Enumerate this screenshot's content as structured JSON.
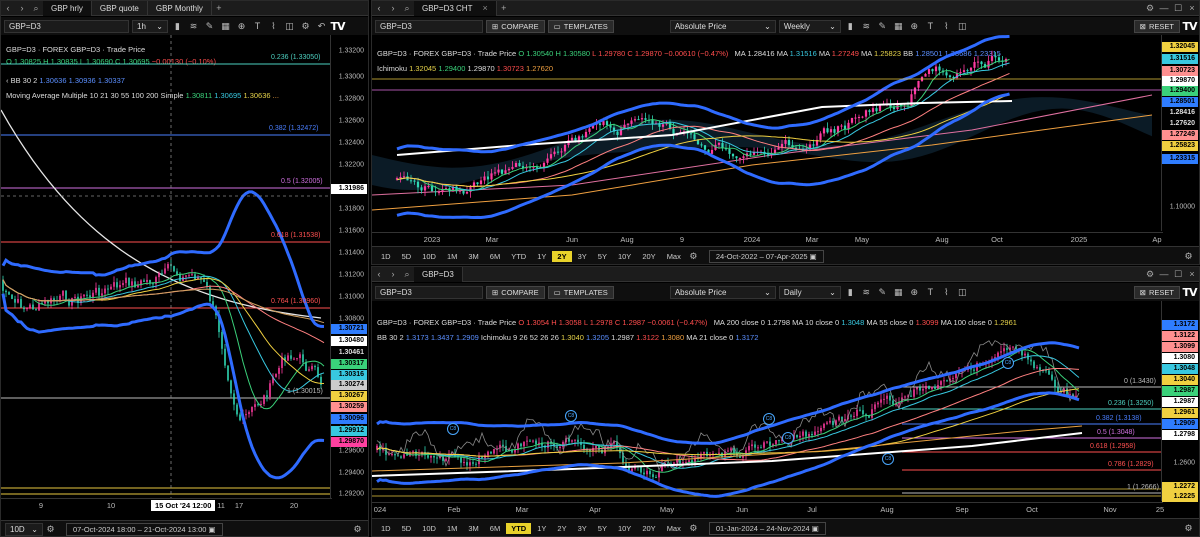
{
  "left": {
    "tabs": [
      {
        "label": "GBP hrly",
        "active": true
      },
      {
        "label": "GBP quote"
      },
      {
        "label": "GBP Monthly"
      }
    ],
    "symbol": "GBP=D3",
    "interval": "1h",
    "legend": {
      "title": "GBP=D3 · FOREX GBP=D3 · Trade Price",
      "o": "O 1.30825",
      "h": "H 1.30835",
      "l": "L 1.30690",
      "c": "C 1.30695",
      "chg": "−0.00130 (−0.10%)",
      "bb_name": "BB 30 2",
      "bb_v1": "1.30636",
      "bb_v2": "1.30936",
      "bb_v3": "1.30337",
      "ma_name": "Moving Average Multiple 10 21 30 55 100 200 Simple",
      "ma_v1": "1.30811",
      "ma_v2": "1.30695",
      "ma_v3": "1.30636",
      "ma_more": "..."
    },
    "fibs": [
      {
        "label": "0.236 (1.33050)",
        "color": "#4dd0c0"
      },
      {
        "label": "0.382 (1.32472)",
        "color": "#4a7fff"
      },
      {
        "label": "0.5 (1.32005)",
        "color": "#d070e0"
      },
      {
        "label": "0.618 (1.31538)",
        "color": "#ff5050"
      },
      {
        "label": "0.764 (1.30960)",
        "color": "#ff5050"
      },
      {
        "label": "1 (1.30015)",
        "color": "#bbbbbb"
      }
    ],
    "price_ticks": [
      "1.33200",
      "1.33000",
      "1.32800",
      "1.32600",
      "1.32400",
      "1.32200",
      "1.31800",
      "1.31600",
      "1.31400",
      "1.31200",
      "1.31000",
      "1.30800",
      "1.30600",
      "1.30400",
      "1.30200",
      "1.30000",
      "1.29800",
      "1.29600",
      "1.29400",
      "1.29200"
    ],
    "price_tags": [
      {
        "text": "1.31986",
        "bg": "#ffffff"
      },
      {
        "text": "1.30721",
        "bg": "#2f7dff"
      },
      {
        "text": "1.30480",
        "bg": "#ffffff"
      },
      {
        "text": "1.30461",
        "bg": "#000000",
        "fg": "#ddd"
      },
      {
        "text": "1.30317",
        "bg": "#3ad17a"
      },
      {
        "text": "1.30316",
        "bg": "#38c8e0"
      },
      {
        "text": "1.30274",
        "bg": "#cccccc"
      },
      {
        "text": "1.30267",
        "bg": "#f0d040"
      },
      {
        "text": "1.30259",
        "bg": "#ff9090"
      },
      {
        "text": "1.30096",
        "bg": "#2f7dff"
      },
      {
        "text": "1.29912",
        "bg": "#38c8e0"
      },
      {
        "text": "1.29870",
        "bg": "#ff40a0"
      }
    ],
    "time_ticks": [
      "9",
      "10",
      "11",
      "17",
      "20"
    ],
    "crosshair_time": "15 Oct '24  12:00",
    "range_select": "10D",
    "date_range": "07-Oct-2024 18:00 – 21-Oct-2024 13:00"
  },
  "rtop": {
    "tab": "GBP=D3 CHT",
    "symbol": "GBP=D3",
    "compare": "COMPARE",
    "templates": "TEMPLATES",
    "price_mode": "Absolute Price",
    "interval": "Weekly",
    "reset": "RESET",
    "legend": {
      "title": "GBP=D3 · FOREX GBP=D3 · Trade Price",
      "o": "O 1.30540",
      "h": "H 1.30580",
      "l": "L 1.29780",
      "c": "C 1.29870",
      "chg": "−0.00610 (−0.47%)",
      "ma1_name": "MA",
      "ma1_v": "1.28416",
      "ma2_name": "MA",
      "ma2_v": "1.31516",
      "ma3_name": "MA",
      "ma3_v": "1.27249",
      "ma4_name": "MA",
      "ma4_v": "1.25823",
      "bb_name": "BB",
      "bb_v1": "1.28501",
      "bb_v2": "1.33686",
      "bb_v3": "1.23315",
      "ichi_name": "Ichimoku",
      "ichi_v1": "1.32045",
      "ichi_v2": "1.29400",
      "ichi_v3": "1.29870",
      "ichi_v4": "1.30723",
      "ichi_v5": "1.27620"
    },
    "price_ticks": [
      "1.10000"
    ],
    "price_tags": [
      {
        "text": "1.32045",
        "bg": "#f0d040"
      },
      {
        "text": "1.31516",
        "bg": "#38c8e0"
      },
      {
        "text": "1.30723",
        "bg": "#ff9090"
      },
      {
        "text": "1.29870",
        "bg": "#ffffff"
      },
      {
        "text": "1.29400",
        "bg": "#3ad17a"
      },
      {
        "text": "1.28501",
        "bg": "#2f7dff"
      },
      {
        "text": "1.28416",
        "bg": "#000000",
        "fg": "#ddd"
      },
      {
        "text": "1.27620",
        "bg": "#000000",
        "fg": "#ddd"
      },
      {
        "text": "1.27249",
        "bg": "#ff9090"
      },
      {
        "text": "1.25823",
        "bg": "#f0d040"
      },
      {
        "text": "1.23315",
        "bg": "#2f7dff"
      }
    ],
    "time_ticks": [
      "2023",
      "Mar",
      "Jun",
      "Aug",
      "9",
      "2024",
      "Mar",
      "May",
      "Aug",
      "Oct",
      "2025",
      "Ap"
    ],
    "ranges": [
      "1D",
      "5D",
      "10D",
      "1M",
      "3M",
      "6M",
      "YTD",
      "1Y",
      "2Y",
      "3Y",
      "5Y",
      "10Y",
      "20Y",
      "Max"
    ],
    "active_range": "2Y",
    "date_range": "24-Oct-2022 – 07-Apr-2025"
  },
  "rbot": {
    "symbol": "GBP=D3",
    "compare": "COMPARE",
    "templates": "TEMPLATES",
    "price_mode": "Absolute Price",
    "interval": "Daily",
    "reset": "RESET",
    "legend": {
      "title": "GBP=D3 · FOREX GBP=D3 · Trade Price",
      "o": "O 1.3054",
      "h": "H 1.3058",
      "l": "L 1.2978",
      "c": "C 1.2987",
      "chg": "−0.0061 (−0.47%)",
      "ma200": "MA 200 close 0",
      "ma200_v": "1.2798",
      "ma10": "MA 10 close 0",
      "ma10_v": "1.3048",
      "ma55": "MA 55 close 0",
      "ma55_v": "1.3099",
      "ma100": "MA 100 close 0",
      "ma100_v": "1.2961",
      "bb_name": "BB 30 2",
      "bb_v1": "1.3173",
      "bb_v2": "1.3437",
      "bb_v3": "1.2909",
      "ichi_name": "Ichimoku 9 26 52 26 26",
      "ichi_v1": "1.3040",
      "ichi_v2": "1.3205",
      "ichi_v3": "1.2987",
      "ichi_v4": "1.3122",
      "ichi_v5": "1.3080",
      "ma21": "MA 21 close 0",
      "ma21_v": "1.3172"
    },
    "fibs": [
      {
        "label": "0 (1.3430)",
        "color": "#bbbbbb"
      },
      {
        "label": "0.236 (1.3250)",
        "color": "#4dd0c0"
      },
      {
        "label": "0.382 (1.3138)",
        "color": "#4a7fff"
      },
      {
        "label": "0.5 (1.3048)",
        "color": "#d070e0"
      },
      {
        "label": "0.618 (1.2958)",
        "color": "#ff5050"
      },
      {
        "label": "0.786 (1.2829)",
        "color": "#ff5050"
      },
      {
        "label": "1 (1.2666)",
        "color": "#bbbbbb"
      }
    ],
    "price_ticks": [
      "1.2600"
    ],
    "price_tags": [
      {
        "text": "1.3172",
        "bg": "#2f7dff"
      },
      {
        "text": "1.3122",
        "bg": "#ff9090"
      },
      {
        "text": "1.3099",
        "bg": "#ff9090"
      },
      {
        "text": "1.3080",
        "bg": "#ffffff"
      },
      {
        "text": "1.3048",
        "bg": "#38c8e0"
      },
      {
        "text": "1.3040",
        "bg": "#f0d040"
      },
      {
        "text": "1.2987",
        "bg": "#3ad17a"
      },
      {
        "text": "1.2987",
        "bg": "#ffffff"
      },
      {
        "text": "1.2961",
        "bg": "#f0d040"
      },
      {
        "text": "1.2909",
        "bg": "#2f7dff"
      },
      {
        "text": "1.2798",
        "bg": "#ffffff"
      },
      {
        "text": "1.2272",
        "bg": "#f0d040"
      },
      {
        "text": "1.2225",
        "bg": "#f0d040"
      }
    ],
    "badge_text": "C8",
    "time_ticks": [
      "024",
      "Feb",
      "Mar",
      "Apr",
      "May",
      "Jun",
      "Jul",
      "Aug",
      "Sep",
      "Oct",
      "Nov",
      "25"
    ],
    "ranges": [
      "1D",
      "5D",
      "10D",
      "1M",
      "3M",
      "6M",
      "YTD",
      "1Y",
      "2Y",
      "3Y",
      "5Y",
      "10Y",
      "20Y",
      "Max"
    ],
    "active_range": "YTD",
    "date_range": "01-Jan-2024 – 24-Nov-2024"
  },
  "icons": [
    "back-icon",
    "search-icon",
    "settings-icon",
    "chart-type-icon",
    "draw-icon",
    "close-icon",
    "tradingview-logo-icon",
    "calendar-icon",
    "folder-icon"
  ]
}
